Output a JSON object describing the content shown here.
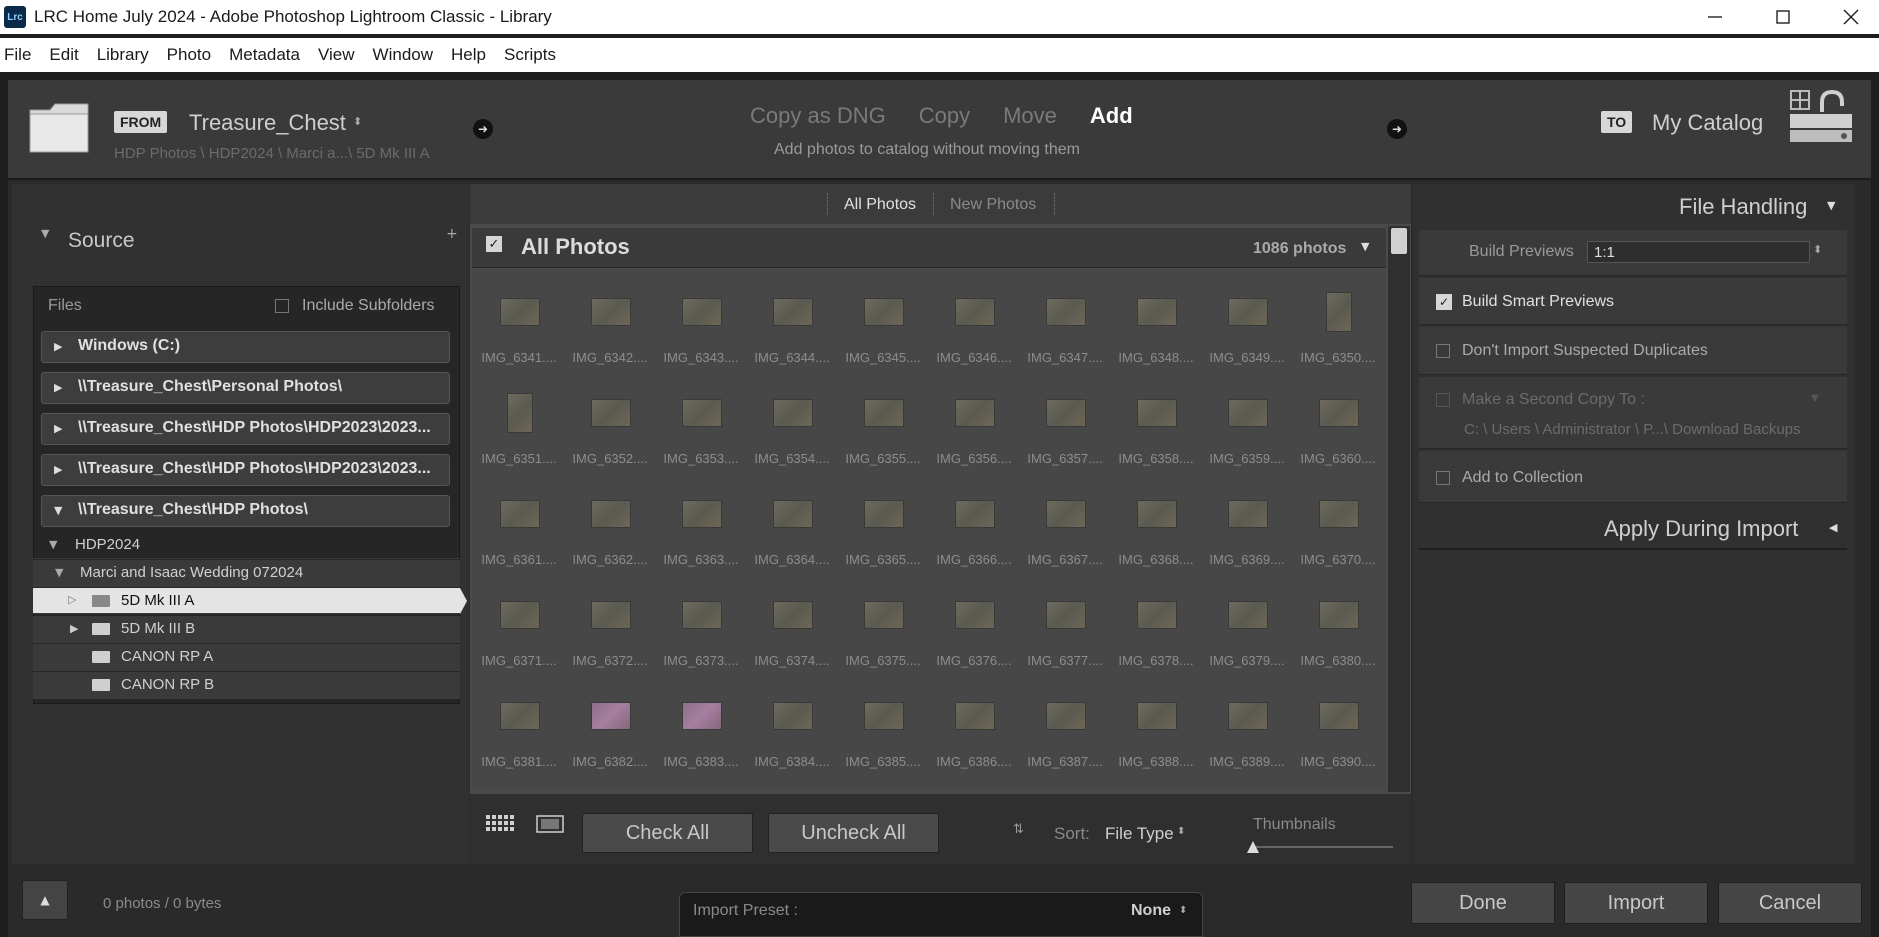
{
  "window": {
    "app_icon": "Lrc",
    "title": "LRC Home July 2024 - Adobe Photoshop Lightroom Classic - Library"
  },
  "menu": [
    "File",
    "Edit",
    "Library",
    "Photo",
    "Metadata",
    "View",
    "Window",
    "Help",
    "Scripts"
  ],
  "header": {
    "from_tag": "FROM",
    "source_name": "Treasure_Chest",
    "source_path": "HDP Photos \\ HDP2024 \\ Marci a...\\ 5D Mk III A",
    "modes": [
      "Copy as DNG",
      "Copy",
      "Move",
      "Add"
    ],
    "active_mode": "Add",
    "mode_description": "Add photos to catalog without moving them",
    "to_tag": "TO",
    "dest_name": "My Catalog"
  },
  "source_panel": {
    "title": "Source",
    "files_label": "Files",
    "include_subfolders": "Include Subfolders",
    "volumes": [
      "Windows (C:)",
      "\\\\Treasure_Chest\\Personal Photos\\",
      "\\\\Treasure_Chest\\HDP Photos\\HDP2023\\2023...",
      "\\\\Treasure_Chest\\HDP Photos\\HDP2023\\2023...",
      "\\\\Treasure_Chest\\HDP Photos\\"
    ],
    "tree": {
      "hdp2024": "HDP2024",
      "wedding": "Marci and Isaac Wedding  072024",
      "folders": [
        "5D Mk III A",
        "5D Mk III B",
        "CANON RP A",
        "CANON RP B"
      ],
      "selected": "5D Mk III A"
    }
  },
  "center": {
    "tabs": [
      "All Photos",
      "New Photos"
    ],
    "active_tab": "All Photos",
    "grid_title": "All Photos",
    "photo_count": "1086 photos",
    "photos": [
      "IMG_6341....",
      "IMG_6342....",
      "IMG_6343....",
      "IMG_6344....",
      "IMG_6345....",
      "IMG_6346....",
      "IMG_6347....",
      "IMG_6348....",
      "IMG_6349....",
      "IMG_6350....",
      "IMG_6351....",
      "IMG_6352....",
      "IMG_6353....",
      "IMG_6354....",
      "IMG_6355....",
      "IMG_6356....",
      "IMG_6357....",
      "IMG_6358....",
      "IMG_6359....",
      "IMG_6360....",
      "IMG_6361....",
      "IMG_6362....",
      "IMG_6363....",
      "IMG_6364....",
      "IMG_6365....",
      "IMG_6366....",
      "IMG_6367....",
      "IMG_6368....",
      "IMG_6369....",
      "IMG_6370....",
      "IMG_6371....",
      "IMG_6372....",
      "IMG_6373....",
      "IMG_6374....",
      "IMG_6375....",
      "IMG_6376....",
      "IMG_6377....",
      "IMG_6378....",
      "IMG_6379....",
      "IMG_6380....",
      "IMG_6381....",
      "IMG_6382....",
      "IMG_6383....",
      "IMG_6384....",
      "IMG_6385....",
      "IMG_6386....",
      "IMG_6387....",
      "IMG_6388....",
      "IMG_6389....",
      "IMG_6390...."
    ],
    "portrait_photos": [
      "IMG_6350....",
      "IMG_6351...."
    ],
    "pink_photos": [
      "IMG_6382....",
      "IMG_6383...."
    ],
    "check_all": "Check All",
    "uncheck_all": "Uncheck All",
    "sort_label": "Sort:",
    "sort_value": "File Type",
    "thumbnails_label": "Thumbnails",
    "thumbnail_size": 0
  },
  "file_handling": {
    "title": "File Handling",
    "build_previews_label": "Build Previews",
    "build_previews_value": "1:1",
    "build_smart_previews": "Build Smart Previews",
    "build_smart_previews_checked": true,
    "dont_import_duplicates": "Don't Import Suspected Duplicates",
    "second_copy": "Make a Second Copy To :",
    "second_copy_path": "C: \\ Users \\ Administrator \\ P...\\ Download Backups",
    "add_to_collection": "Add to Collection"
  },
  "apply_during_import": {
    "title": "Apply During Import"
  },
  "footer": {
    "status": "0 photos / 0 bytes",
    "import_preset_label": "Import Preset :",
    "import_preset_value": "None",
    "done": "Done",
    "import": "Import",
    "cancel": "Cancel"
  },
  "colors": {
    "panel_bg": "#303030",
    "grid_bg": "#474747",
    "selection_bg": "#e4e4e4",
    "text_light": "#cfcfcf"
  }
}
